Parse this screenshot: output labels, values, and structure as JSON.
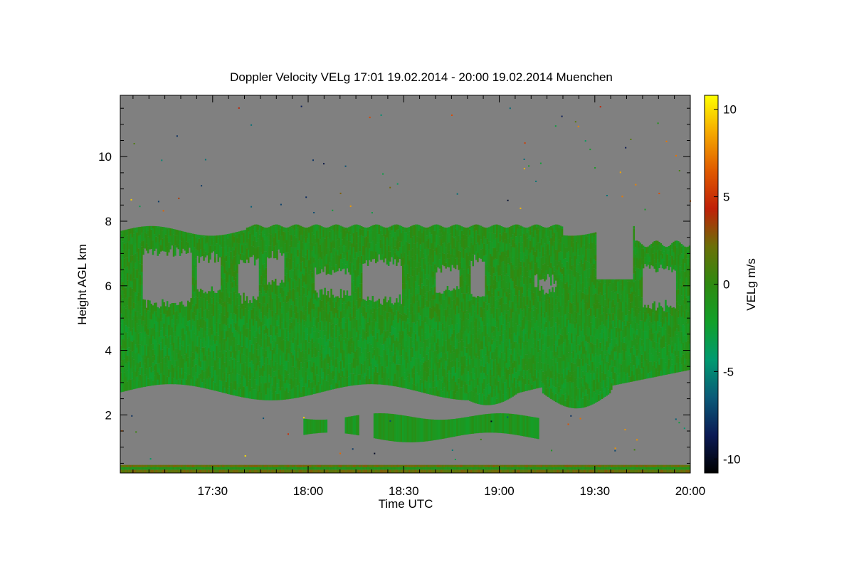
{
  "chart_data": {
    "type": "heatmap",
    "title": "Doppler Velocity VELg   17:01 19.02.2014 - 20:00 19.02.2014 Muenchen",
    "xlabel": "Time UTC",
    "ylabel": "Height AGL km",
    "colorbar_label": "VELg m/s",
    "x_tick_labels": [
      "17:30",
      "18:00",
      "18:30",
      "19:00",
      "19:30",
      "20:00"
    ],
    "x_tick_minutes": [
      1050,
      1080,
      1110,
      1140,
      1170,
      1200
    ],
    "xlim_minutes": [
      1021,
      1200
    ],
    "y_ticks": [
      2,
      4,
      6,
      8,
      10
    ],
    "ylim": [
      0.2,
      11.9
    ],
    "colorbar_ticks": [
      -10,
      -5,
      0,
      5,
      10
    ],
    "colorbar_labels": [
      "-10",
      "-5",
      "0",
      "5",
      "10"
    ],
    "clim": [
      -10.8,
      10.8
    ],
    "no_data_color": "#808080",
    "colormap": [
      "#000000",
      "#0b1a55",
      "#0a5a78",
      "#009a70",
      "#12a02a",
      "#2e8a10",
      "#6b7008",
      "#c02008",
      "#e05a00",
      "#f5a800",
      "#ffff00"
    ],
    "cloud_layers": [
      {
        "t_start": 1021,
        "t_end": 1200,
        "h_bottom": 2.7,
        "h_top": 4.85,
        "mean_velocity": -1.5
      },
      {
        "t_start": 1021,
        "t_end": 1200,
        "h_bottom": 4.85,
        "h_top": 7.85,
        "mean_velocity": -1.0
      },
      {
        "t_start": 1074,
        "t_end": 1152,
        "h_bottom": 1.25,
        "h_top": 2.0,
        "mean_velocity": -1.5
      }
    ],
    "surface_clutter": {
      "h_bottom": 0.2,
      "h_top": 0.45,
      "mean_velocity": 2.0
    }
  }
}
